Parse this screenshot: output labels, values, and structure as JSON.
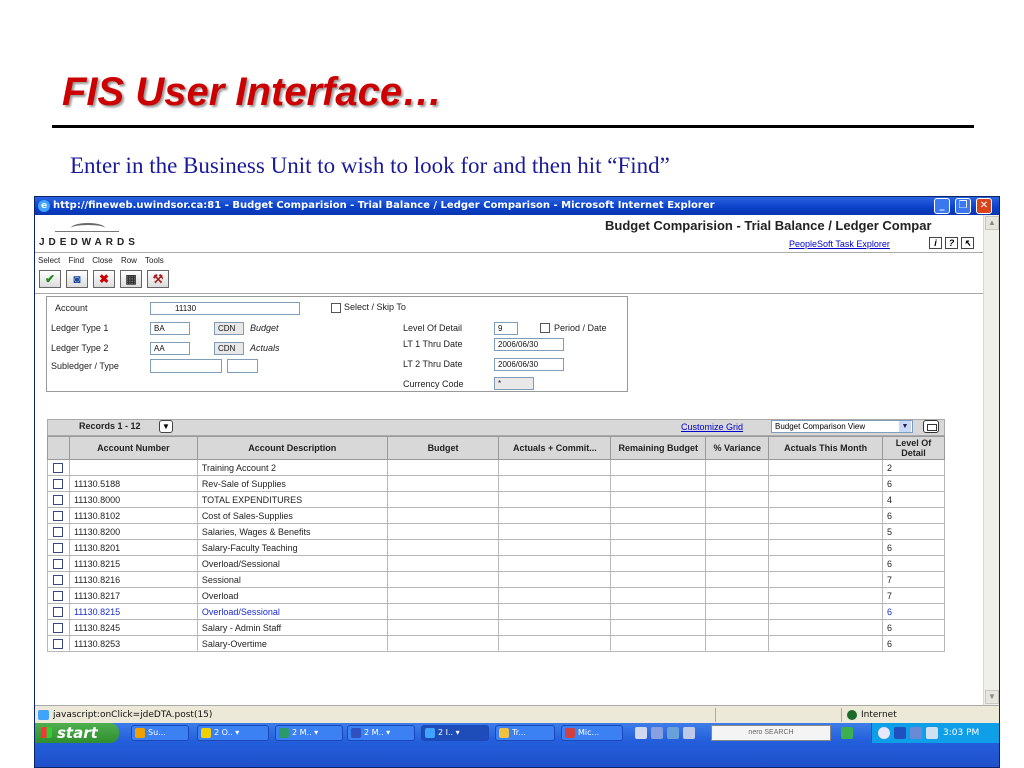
{
  "slide": {
    "title": "FIS User Interface…",
    "subtitle": "Enter in the Business Unit to wish to look for and then hit “Find”"
  },
  "window": {
    "title": "http://fineweb.uwindsor.ca:81 - Budget Comparision - Trial Balance / Ledger Comparison - Microsoft Internet Explorer"
  },
  "header": {
    "logo_text": "JDEDWARDS",
    "app_title": "Budget Comparision - Trial Balance / Ledger Compar",
    "peoplesoft_link": "PeopleSoft Task Explorer",
    "icons": [
      "info-icon",
      "help-icon",
      "help-pointer-icon"
    ]
  },
  "menu": {
    "items": [
      "Select",
      "Find",
      "Close",
      "Row",
      "Tools"
    ]
  },
  "toolbar": {
    "buttons": [
      {
        "name": "select-button",
        "icon": "check-icon",
        "glyph": "✔",
        "color": "#1a8a1a"
      },
      {
        "name": "find-button",
        "icon": "find-icon",
        "glyph": "🔍",
        "color": "#1a4aa0"
      },
      {
        "name": "close-button",
        "icon": "close-icon",
        "glyph": "✖",
        "color": "#cc0000"
      },
      {
        "name": "row-button",
        "icon": "grid-row-icon",
        "glyph": "▦",
        "color": "#333333"
      },
      {
        "name": "tools-button",
        "icon": "tools-icon",
        "glyph": "⚒",
        "color": "#aa2222"
      }
    ]
  },
  "form": {
    "account_label": "Account",
    "account_value": "11130",
    "select_skip_label": "Select / Skip To",
    "ledger_type_1_label": "Ledger Type 1",
    "ledger_type_1_value": "BA",
    "ledger_type_1_currency": "CDN",
    "ledger_type_1_desc": "Budget",
    "ledger_type_2_label": "Ledger Type 2",
    "ledger_type_2_value": "AA",
    "ledger_type_2_currency": "CDN",
    "ledger_type_2_desc": "Actuals",
    "subledger_label": "Subledger / Type",
    "level_of_detail_label": "Level Of Detail",
    "level_of_detail_value": "9",
    "period_date_label": "Period / Date",
    "lt1_thru_label": "LT 1 Thru Date",
    "lt1_thru_value": "2006/06/30",
    "lt2_thru_label": "LT 2 Thru Date",
    "lt2_thru_value": "2006/06/30",
    "currency_code_label": "Currency Code",
    "currency_code_value": "*"
  },
  "grid": {
    "records_label": "Records 1 - 12",
    "customize_link": "Customize Grid",
    "view_selected": "Budget Comparison View",
    "columns": [
      "Account Number",
      "Account Description",
      "Budget",
      "Actuals + Commit...",
      "Remaining Budget",
      "% Variance",
      "Actuals This Month",
      "Level Of Detail"
    ],
    "rows": [
      {
        "account": "",
        "description": "Training Account 2",
        "level": "2",
        "highlight": false
      },
      {
        "account": "11130.5188",
        "description": "Rev-Sale of Supplies",
        "level": "6",
        "highlight": false
      },
      {
        "account": "11130.8000",
        "description": "TOTAL EXPENDITURES",
        "level": "4",
        "highlight": false
      },
      {
        "account": "11130.8102",
        "description": "Cost of Sales-Supplies",
        "level": "6",
        "highlight": false
      },
      {
        "account": "11130.8200",
        "description": "Salaries, Wages & Benefits",
        "level": "5",
        "highlight": false
      },
      {
        "account": "11130.8201",
        "description": "Salary-Faculty Teaching",
        "level": "6",
        "highlight": false
      },
      {
        "account": "11130.8215",
        "description": "Overload/Sessional",
        "level": "6",
        "highlight": false
      },
      {
        "account": "11130.8216",
        "description": "Sessional",
        "level": "7",
        "highlight": false
      },
      {
        "account": "11130.8217",
        "description": "Overload",
        "level": "7",
        "highlight": false
      },
      {
        "account": "11130.8215",
        "description": "Overload/Sessional",
        "level": "6",
        "highlight": true
      },
      {
        "account": "11130.8245",
        "description": "Salary - Admin Staff",
        "level": "6",
        "highlight": false
      },
      {
        "account": "11130.8253",
        "description": "Salary-Overtime",
        "level": "6",
        "highlight": false
      }
    ]
  },
  "statusbar": {
    "text": "javascript:onClick=jdeDTA.post(15)",
    "zone": "Internet"
  },
  "taskbar": {
    "start_label": "start",
    "tasks": [
      {
        "label": "Su...",
        "color": "#f0a000"
      },
      {
        "label": "2 O.. ▾",
        "color": "#f0d000"
      },
      {
        "label": "2 M.. ▾",
        "color": "#2a9a6a"
      },
      {
        "label": "2 M.. ▾",
        "color": "#3050c0"
      },
      {
        "label": "2 I.. ▾",
        "color": "#3fa3ff"
      },
      {
        "label": "Tr...",
        "color": "#f0c040"
      },
      {
        "label": "Mic...",
        "color": "#d04040"
      }
    ],
    "nero_label": "nero SEARCH",
    "clock": "3:03 PM"
  },
  "colors": {
    "title_red": "#cc0000",
    "subtitle_blue": "#1a1a99",
    "xp_blue": "#245edb",
    "link_blue": "#0000cc"
  }
}
